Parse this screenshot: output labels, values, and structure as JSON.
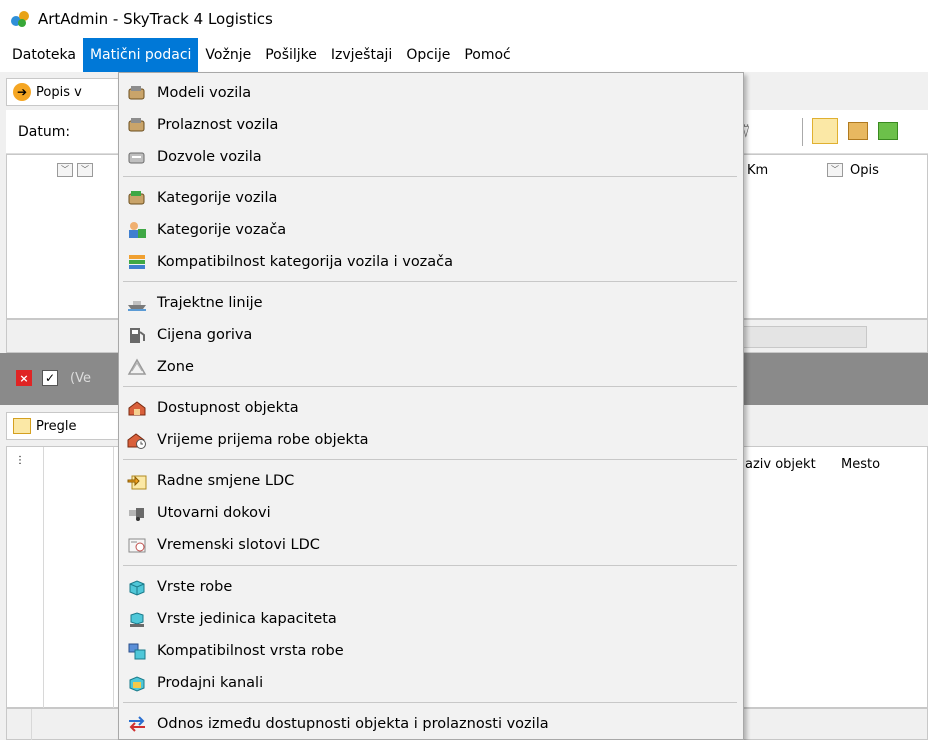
{
  "window": {
    "title": "ArtAdmin - SkyTrack 4 Logistics"
  },
  "menubar": {
    "items": [
      {
        "label": "Datoteka"
      },
      {
        "label": "Matični podaci",
        "active": true
      },
      {
        "label": "Vožnje"
      },
      {
        "label": "Pošiljke"
      },
      {
        "label": "Izvještaji"
      },
      {
        "label": "Opcije"
      },
      {
        "label": "Pomoć"
      }
    ]
  },
  "background": {
    "panel1_tab": "Popis v",
    "toolbar_label": "Datum:",
    "grid1_headers": [
      "Km",
      "Opis"
    ],
    "strip_text": "(Ve",
    "panel2_tab": "Pregle",
    "grid2_headers": [
      "aziv objekt",
      "Mesto"
    ]
  },
  "dropdown": {
    "items": [
      {
        "label": "Modeli vozila",
        "icon": "vehicle-model-icon"
      },
      {
        "label": "Prolaznost vozila",
        "icon": "vehicle-pass-icon"
      },
      {
        "label": "Dozvole vozila",
        "icon": "vehicle-permit-icon"
      },
      {
        "label": "Kategorije vozila",
        "icon": "vehicle-category-icon"
      },
      {
        "label": "Kategorije vozača",
        "icon": "driver-category-icon"
      },
      {
        "label": "Kompatibilnost kategorija vozila i vozača",
        "icon": "compatibility-list-icon"
      },
      {
        "label": "Trajektne linije",
        "icon": "ferry-icon"
      },
      {
        "label": "Cijena goriva",
        "icon": "fuel-pump-icon"
      },
      {
        "label": "Zone",
        "icon": "zones-icon"
      },
      {
        "label": "Dostupnost objekta",
        "icon": "facility-availability-icon"
      },
      {
        "label": "Vrijeme prijema robe objekta",
        "icon": "facility-receive-time-icon"
      },
      {
        "label": "Radne smjene LDC",
        "icon": "work-shift-icon"
      },
      {
        "label": "Utovarni dokovi",
        "icon": "loading-dock-icon"
      },
      {
        "label": "Vremenski slotovi LDC",
        "icon": "time-slot-icon"
      },
      {
        "label": "Vrste robe",
        "icon": "goods-type-icon"
      },
      {
        "label": "Vrste jedinica kapaciteta",
        "icon": "capacity-unit-icon"
      },
      {
        "label": "Kompatibilnost vrsta robe",
        "icon": "goods-compatibility-icon"
      },
      {
        "label": "Prodajni kanali",
        "icon": "sales-channel-icon"
      },
      {
        "label": "Odnos između dostupnosti objekta i prolaznosti vozila",
        "icon": "relation-arrows-icon"
      }
    ]
  }
}
